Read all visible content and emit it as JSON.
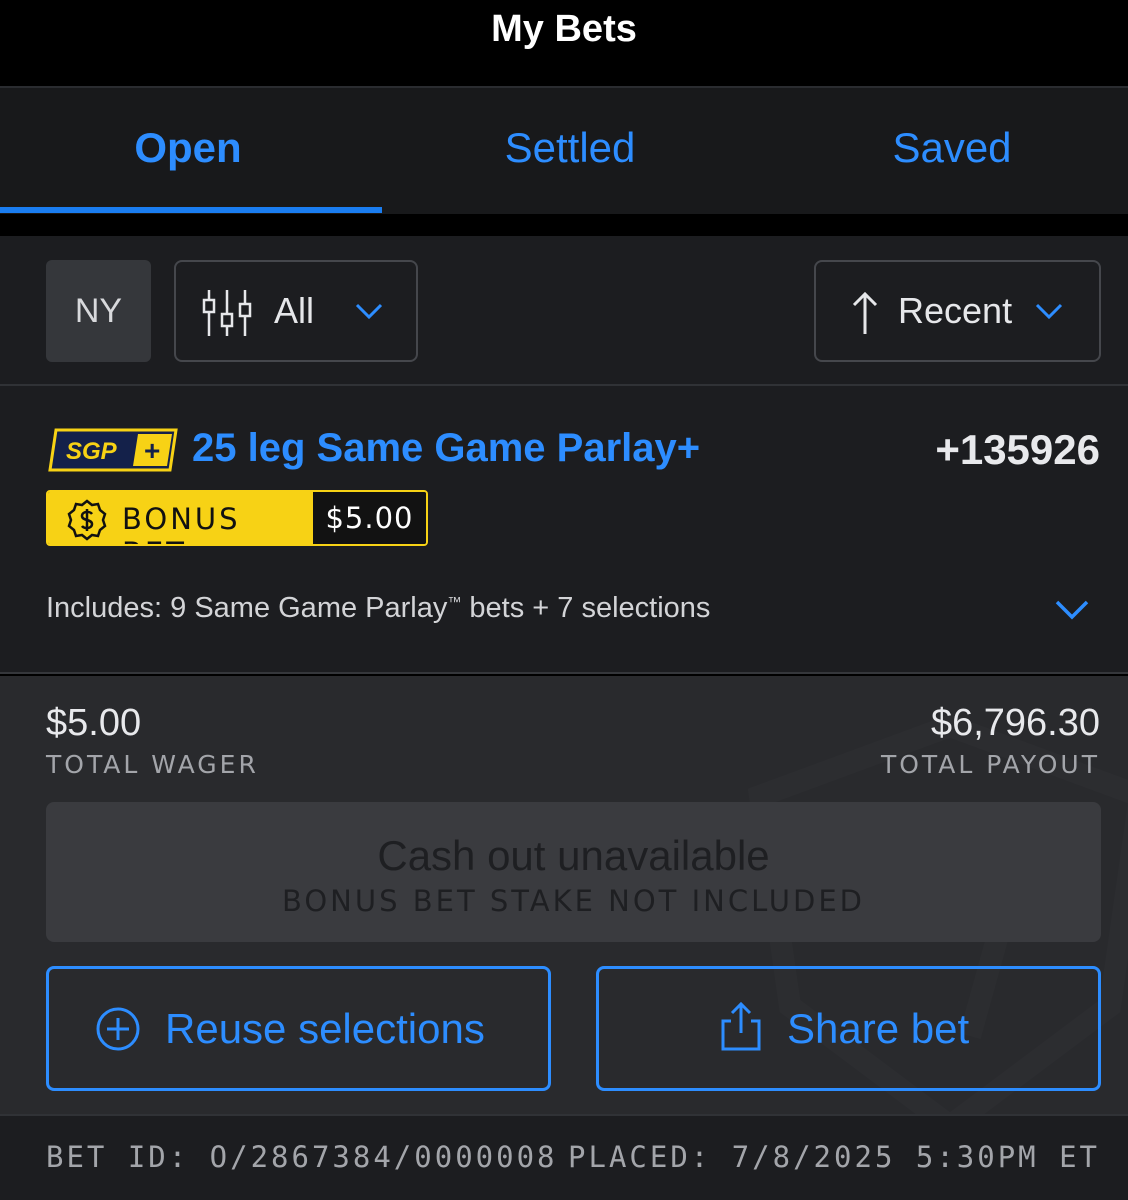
{
  "header": {
    "title": "My Bets"
  },
  "tabs": [
    {
      "label": "Open",
      "active": true
    },
    {
      "label": "Settled",
      "active": false
    },
    {
      "label": "Saved",
      "active": false
    }
  ],
  "filters": {
    "state": "NY",
    "type_filter": "All",
    "sort": "Recent",
    "icons": {
      "type": "sliders-icon",
      "sort": "arrow-up-icon",
      "dropdown": "chevron-down-icon"
    }
  },
  "bet": {
    "badge_text": "SGP",
    "badge_plus": "+",
    "title": "25 leg Same Game Parlay+",
    "odds": "+135926",
    "bonus_label": "BONUS BET",
    "bonus_amount": "$5.00",
    "includes_prefix": "Includes: 9 Same Game Parlay",
    "includes_tm": "™",
    "includes_suffix": " bets + 7 selections",
    "total_wager": "$5.00",
    "total_wager_label": "TOTAL WAGER",
    "total_payout": "$6,796.30",
    "total_payout_label": "TOTAL PAYOUT",
    "cashout_main": "Cash out unavailable",
    "cashout_sub": "BONUS BET STAKE NOT INCLUDED",
    "reuse_label": "Reuse selections",
    "share_label": "Share bet",
    "bet_id": "BET ID: O/2867384/0000008",
    "placed": "PLACED: 7/8/2025 5:30PM ET"
  },
  "colors": {
    "accent": "#2d8dff",
    "bonus_yellow": "#f7d215",
    "badge_navy": "#14214a"
  }
}
